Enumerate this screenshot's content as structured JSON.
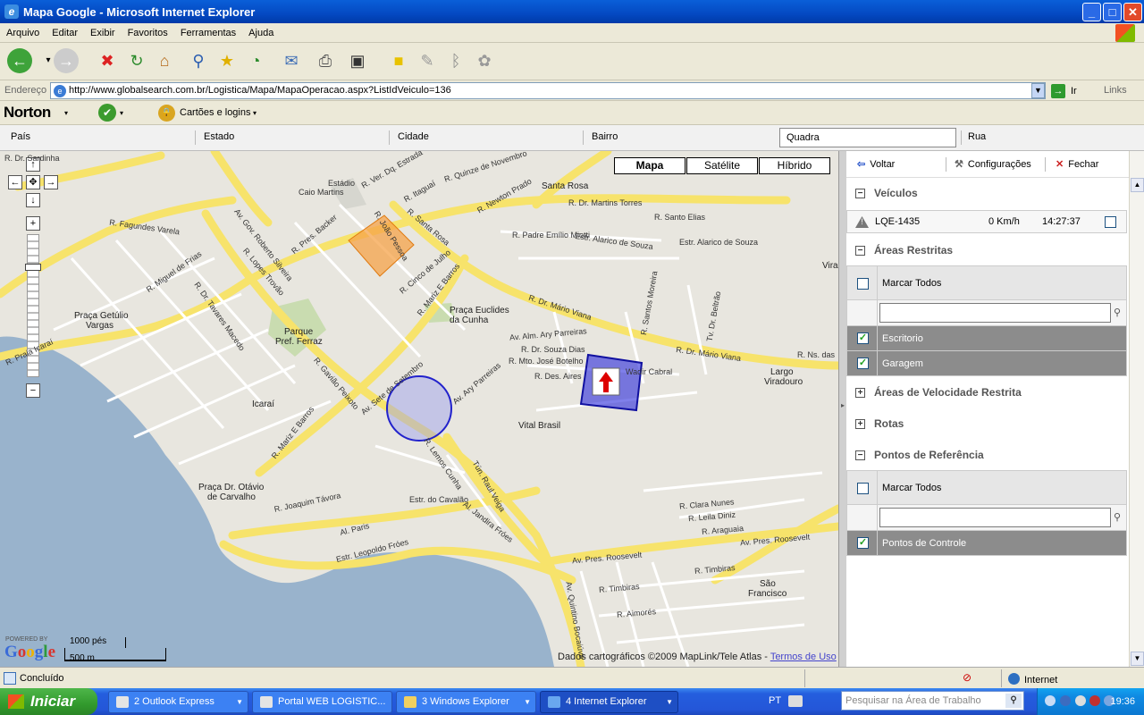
{
  "window": {
    "title": "Mapa Google - Microsoft Internet Explorer",
    "controls": {
      "minimize": "_",
      "maximize": "□",
      "close": "✕"
    }
  },
  "menu": [
    "Arquivo",
    "Editar",
    "Exibir",
    "Favoritos",
    "Ferramentas",
    "Ajuda"
  ],
  "toolbar_icons": [
    "back-icon",
    "forward-icon",
    "stop-icon",
    "refresh-icon",
    "home-icon",
    "search-icon",
    "favorites-icon",
    "history-icon",
    "mail-icon",
    "print-icon",
    "edit-icon",
    "note-icon",
    "messenger-icon",
    "bluetooth-icon",
    "research-icon"
  ],
  "address": {
    "label": "Endereço",
    "url": "http://www.globalsearch.com.br/Logistica/Mapa/MapaOperacao.aspx?ListIdVeiculo=136",
    "go_label": "Ir",
    "links_label": "Links"
  },
  "norton": {
    "brand": "Norton",
    "cards_label": "Cartões e logins"
  },
  "filters": {
    "pais": "País",
    "estado": "Estado",
    "cidade": "Cidade",
    "bairro": "Bairro",
    "quadra": "Quadra",
    "rua": "Rua"
  },
  "map": {
    "types": {
      "mapa": "Mapa",
      "satelite": "Satélite",
      "hibrido": "Híbrido"
    },
    "selected_type": "Mapa",
    "labels": [
      {
        "id": "estadio",
        "text": "Estádio"
      },
      {
        "id": "caio",
        "text": "Caio Martins"
      },
      {
        "id": "santarosa",
        "text": "Santa Rosa"
      },
      {
        "id": "fagundes",
        "text": "R. Fagundes Varela"
      },
      {
        "id": "miguel",
        "text": "R. Miguel de Frias"
      },
      {
        "id": "goveroberto",
        "text": "Av. Gov. Roberto Silveira"
      },
      {
        "id": "presbacker",
        "text": "R. Pres. Backer"
      },
      {
        "id": "santarosa_st",
        "text": "R. Santa Rosa"
      },
      {
        "id": "martinstorres",
        "text": "R. Dr. Martins Torres"
      },
      {
        "id": "santoelias",
        "text": "R. Santo Elias"
      },
      {
        "id": "padremiotti",
        "text": "R. Padre Emílio Miotti"
      },
      {
        "id": "alarico",
        "text": "Estr. Alarico de Souza"
      },
      {
        "id": "alarico2",
        "text": "Estr. Alarico de Souza"
      },
      {
        "id": "mariov",
        "text": "R. Dr. Mário Viana"
      },
      {
        "id": "mariov2",
        "text": "R. Dr. Mário Viana"
      },
      {
        "id": "mariz",
        "text": "R. Mariz E Barros"
      },
      {
        "id": "mariz2",
        "text": "R. Mariz E Barros"
      },
      {
        "id": "euclides",
        "text": "Praça Euclides"
      },
      {
        "id": "cunha",
        "text": "da Cunha"
      },
      {
        "id": "getulio",
        "text": "Praça Getúlio"
      },
      {
        "id": "vargas",
        "text": "Vargas"
      },
      {
        "id": "parque",
        "text": "Parque"
      },
      {
        "id": "ferraz",
        "text": "Pref. Ferraz"
      },
      {
        "id": "icarai",
        "text": "Icaraí"
      },
      {
        "id": "ruaicarai",
        "text": "R. Praia Icaraí"
      },
      {
        "id": "vitalbrasil",
        "text": "Vital Brasil"
      },
      {
        "id": "largo",
        "text": "Largo"
      },
      {
        "id": "viradouro",
        "text": "Viradouro"
      },
      {
        "id": "wadir",
        "text": "Wadir Cabral"
      },
      {
        "id": "otavio",
        "text": "Praça Dr. Otávio"
      },
      {
        "id": "carvalho",
        "text": "de Carvalho"
      },
      {
        "id": "joaquim",
        "text": "R. Joaquim Távora"
      },
      {
        "id": "leopoldo",
        "text": "Estr. Leopoldo Fróes"
      },
      {
        "id": "paris",
        "text": "Al. Paris"
      },
      {
        "id": "presroosevelt",
        "text": "Av. Pres. Roosevelt"
      },
      {
        "id": "presroosevelt2",
        "text": "Av. Pres. Roosevelt"
      },
      {
        "id": "saofrancisco",
        "text": "São"
      },
      {
        "id": "saofrancisco2",
        "text": "Francisco"
      },
      {
        "id": "raulveiga",
        "text": "Tún. Raul Veiga"
      },
      {
        "id": "aryparreiras",
        "text": "Av. Ary Parreiras"
      },
      {
        "id": "alaryp",
        "text": "Av. Alm. Ary Parreiras"
      },
      {
        "id": "setesetembro",
        "text": "Av. Sete de Setembro"
      },
      {
        "id": "gaviao",
        "text": "R. Gavião Peixoto"
      },
      {
        "id": "tavares",
        "text": "R. Dr. Tavares Macedo"
      },
      {
        "id": "nsdas",
        "text": "R. Ns. das"
      },
      {
        "id": "vira",
        "text": "Vira"
      },
      {
        "id": "lupascoa",
        "text": "R. João Pessoa"
      },
      {
        "id": "novembro",
        "text": "R. Quinze de Novembro"
      },
      {
        "id": "verdq",
        "text": "R. Ver. Dq. Estrada"
      },
      {
        "id": "itaguai",
        "text": "R. Itaguaí"
      },
      {
        "id": "neton",
        "text": "R. Newton Prado"
      },
      {
        "id": "sardinha",
        "text": "R. Dr. Sardinha"
      },
      {
        "id": "lopestrovao",
        "text": "R. Lopes Trovão"
      },
      {
        "id": "cincojulho",
        "text": "R. Cinco de Julho"
      },
      {
        "id": "clara",
        "text": "R. Clara Nunes"
      },
      {
        "id": "leila",
        "text": "R. Leila Diniz"
      },
      {
        "id": "araguaia",
        "text": "R. Araguaia"
      },
      {
        "id": "timbiras",
        "text": "R. Timbiras"
      },
      {
        "id": "timbiras2",
        "text": "R. Timbiras"
      },
      {
        "id": "aimores",
        "text": "R. Aimorés"
      },
      {
        "id": "quintino",
        "text": "Av. Quintino Bocaiúva"
      },
      {
        "id": "souzadias",
        "text": "R. Dr. Souza Dias"
      },
      {
        "id": "jbotelho",
        "text": "R. Mto. José Botelho"
      },
      {
        "id": "desaires",
        "text": "R. Des. Aires"
      },
      {
        "id": "almary",
        "text": "Av. Alm. Ary Parreiras"
      },
      {
        "id": "moreira",
        "text": "R. Santos Moreira"
      },
      {
        "id": "beltrao",
        "text": "Tv. Dr. Beltrão"
      },
      {
        "id": "jandira",
        "text": "Al. Jandira Fróes"
      },
      {
        "id": "lemos",
        "text": "R. Lemos Cunha"
      },
      {
        "id": "cavalao",
        "text": "Estr. do Cavalão"
      }
    ],
    "scale_ft": "1000 pés",
    "scale_m": "500 m",
    "powered_by": "POWERED BY",
    "google": "Google",
    "copyright": "Dados cartográficos ©2009 MapLink/Tele Atlas - ",
    "terms": "Termos de Uso"
  },
  "panel": {
    "toolbar": {
      "voltar": "Voltar",
      "config": "Configurações",
      "fechar": "Fechar"
    },
    "veiculos": {
      "title": "Veículos",
      "items": [
        {
          "placa": "LQE-1435",
          "speed": "0 Km/h",
          "time": "14:27:37"
        }
      ]
    },
    "areas": {
      "title": "Áreas Restritas",
      "mark_all": "Marcar Todos",
      "items": [
        "Escritorio",
        "Garagem"
      ]
    },
    "velocidade": {
      "title": "Áreas de Velocidade Restrita"
    },
    "rotas": {
      "title": "Rotas"
    },
    "pontos": {
      "title": "Pontos de Referência",
      "mark_all": "Marcar Todos",
      "items": [
        "Pontos de Controle"
      ]
    }
  },
  "status": {
    "text": "Concluído",
    "zone": "Internet"
  },
  "taskbar": {
    "start": "Iniciar",
    "buttons": [
      "2 Outlook Express",
      "Portal WEB LOGISTIC...",
      "3 Windows Explorer",
      "4 Internet Explorer"
    ],
    "lang": "PT",
    "search_placeholder": "Pesquisar na Área de Trabalho",
    "clock": "19:36"
  }
}
